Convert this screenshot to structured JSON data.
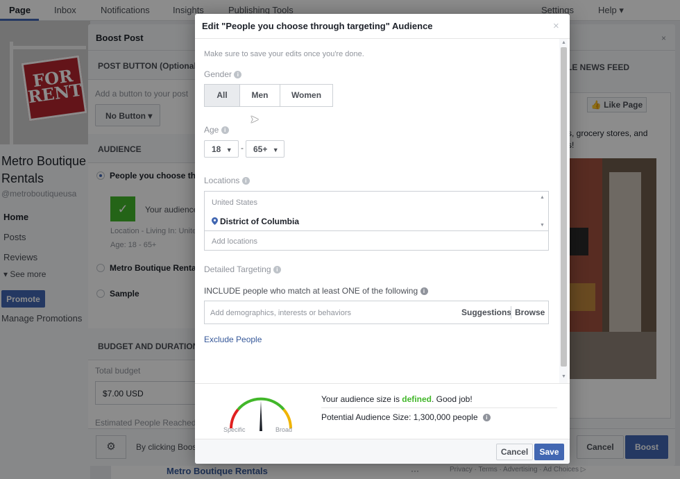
{
  "top_nav": {
    "tabs": [
      "Page",
      "Inbox",
      "Notifications",
      "Insights",
      "Publishing Tools"
    ],
    "settings": "Settings",
    "help": "Help ▾"
  },
  "page_sidebar": {
    "cover_text": "FOR RENT",
    "page_name": "Metro Boutique Rentals",
    "handle": "@metroboutiqueusa",
    "links": [
      "Home",
      "Posts",
      "Reviews",
      "▾ See more"
    ],
    "promote": "Promote",
    "manage_promotions": "Manage Promotions"
  },
  "boost_dialog": {
    "title": "Boost Post",
    "close": "×",
    "post_button_header": "POST BUTTON (Optional)",
    "add_button_label": "Add a button to your post",
    "no_button": "No Button ▾",
    "audience_header": "AUDIENCE",
    "audience_option_1": "People you choose thro",
    "audience_summary": "Your audience",
    "location_summary": "Location - Living In: Unite",
    "age_summary": "Age: 18 - 65+",
    "audience_option_2": "Metro Boutique Rentals",
    "audience_option_3": "Sample",
    "budget_header": "BUDGET AND DURATION",
    "total_budget_label": "Total budget",
    "total_budget_value": "$7.00 USD",
    "reach_label": "Estimated People Reached",
    "terms_prefix": "By clicking Boost",
    "news_feed_header": "LE NEWS FEED",
    "like_page": "Like Page",
    "preview_text_line1": "s, grocery stores, and",
    "preview_text_line2": "s!",
    "cancel": "Cancel",
    "boost": "Boost",
    "bottom_name": "Metro Boutique Rentals",
    "bottom_dots": "···",
    "bottom_legal": "Privacy · Terms · Advertising · Ad Choices ▷"
  },
  "edit_modal": {
    "title": "Edit \"People you choose through targeting\" Audience",
    "close": "×",
    "hint": "Make sure to save your edits once you're done.",
    "gender_label": "Gender",
    "gender_options": [
      "All",
      "Men",
      "Women"
    ],
    "gender_selected": "All",
    "age_label": "Age",
    "age_min": "18",
    "age_max": "65+",
    "age_separator": "-",
    "locations_label": "Locations",
    "location_country": "United States",
    "location_item": "District of Columbia",
    "add_locations_placeholder": "Add locations",
    "detailed_targeting_label": "Detailed Targeting",
    "include_text": "INCLUDE people who match at least ONE of the following",
    "targeting_placeholder": "Add demographics, interests or behaviors",
    "suggestions": "Suggestions",
    "browse": "Browse",
    "exclude_people": "Exclude People",
    "audience_size_prefix": "Your audience size is ",
    "audience_size_status": "defined",
    "audience_size_suffix": ". Good job!",
    "potential_audience": "Potential Audience Size: 1,300,000 people",
    "gauge_specific": "Specific",
    "gauge_broad": "Broad",
    "gauge_level": 0.5,
    "cancel": "Cancel",
    "save": "Save"
  },
  "colors": {
    "accent_blue": "#4267b2",
    "link_blue": "#365899",
    "success_green": "#42b72a"
  }
}
